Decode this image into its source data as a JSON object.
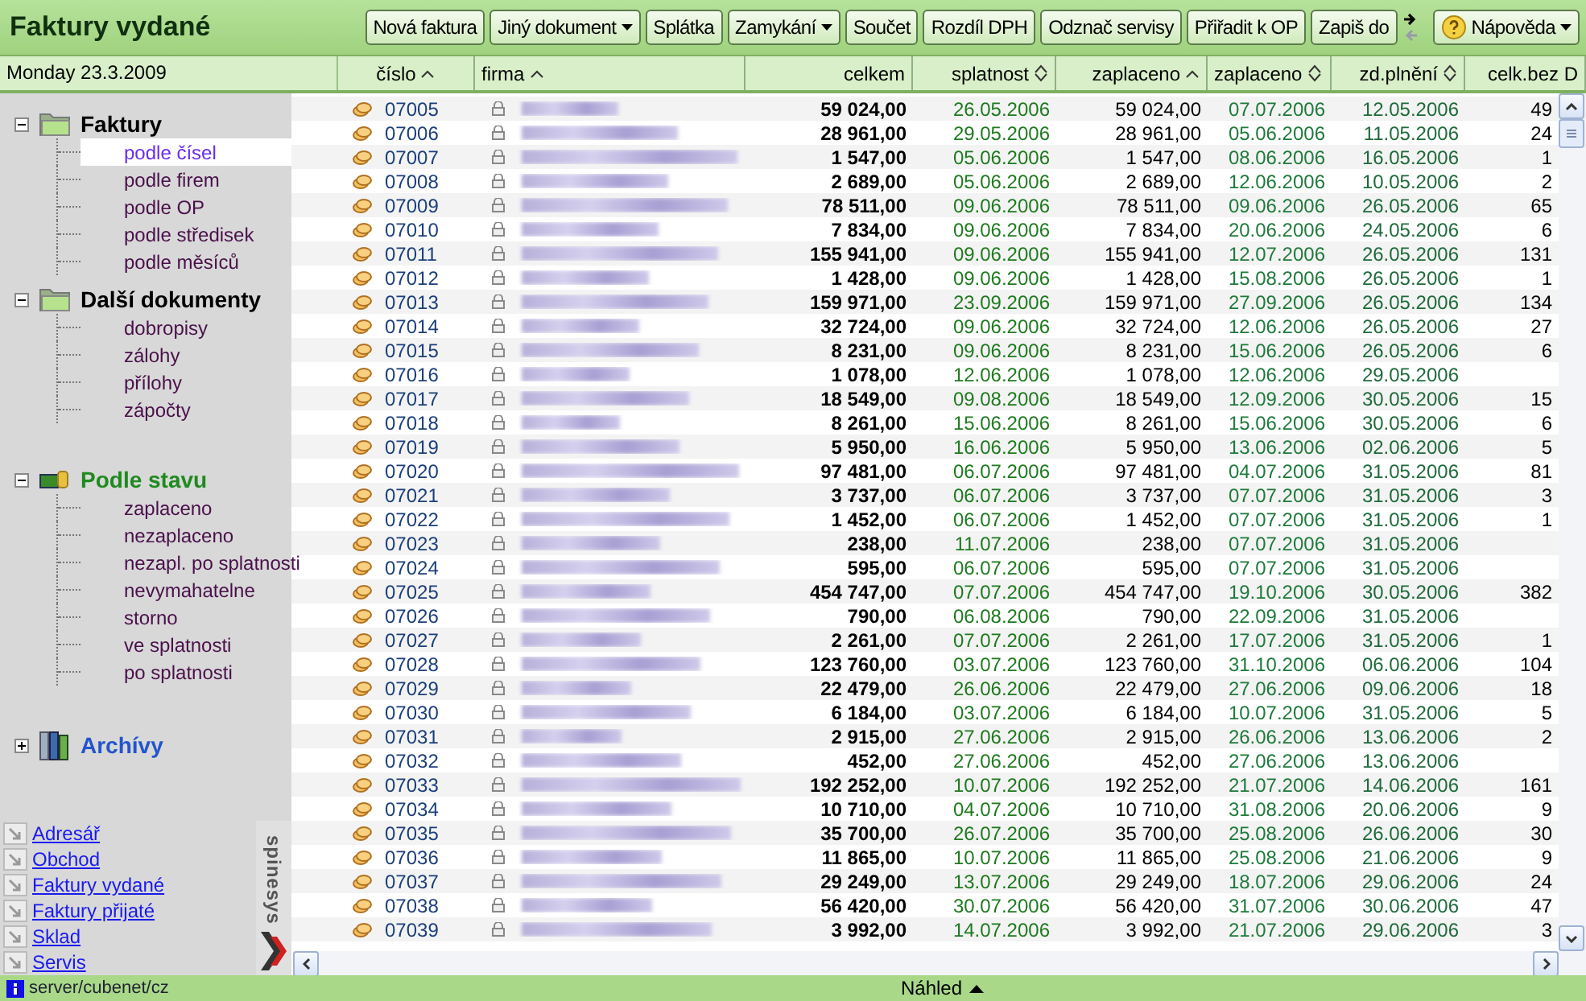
{
  "window": {
    "title": "Faktury vydané"
  },
  "toolbar": [
    {
      "label": "Nová faktura",
      "has_menu": false
    },
    {
      "label": "Jiný dokument",
      "has_menu": true
    },
    {
      "label": "Splátka",
      "has_menu": false
    },
    {
      "label": "Zamykání",
      "has_menu": true
    },
    {
      "label": "Součet",
      "has_menu": false
    },
    {
      "label": "Rozdíl DPH",
      "has_menu": false
    },
    {
      "label": "Odznač servisy",
      "has_menu": false
    },
    {
      "label": "Přiřadit k OP",
      "has_menu": false
    },
    {
      "label": "Zapiš do",
      "has_menu": false
    }
  ],
  "help_button": {
    "label": "Nápověda",
    "has_menu": true
  },
  "date_label": "Monday 23.3.2009",
  "sidebar": {
    "tree": [
      {
        "label": "Faktury",
        "kind": "folder",
        "color": "#000000",
        "expanded": true,
        "children": [
          {
            "label": "podle čísel",
            "selected": true
          },
          {
            "label": "podle firem",
            "selected": false
          },
          {
            "label": "podle OP",
            "selected": false
          },
          {
            "label": "podle středisek",
            "selected": false
          },
          {
            "label": "podle měsíců",
            "selected": false
          }
        ]
      },
      {
        "label": "Další dokumenty",
        "kind": "folder",
        "color": "#000000",
        "expanded": true,
        "children": [
          {
            "label": "dobropisy",
            "selected": false
          },
          {
            "label": "zálohy",
            "selected": false
          },
          {
            "label": "přílohy",
            "selected": false
          },
          {
            "label": "zápočty",
            "selected": false
          }
        ]
      },
      {
        "label": "Podle stavu",
        "kind": "money",
        "color": "#1f8a1f",
        "expanded": true,
        "children": [
          {
            "label": "zaplaceno",
            "selected": false
          },
          {
            "label": "nezaplaceno",
            "selected": false
          },
          {
            "label": "nezapl. po splatnosti",
            "selected": false
          },
          {
            "label": "nevymahatelne",
            "selected": false
          },
          {
            "label": "storno",
            "selected": false
          },
          {
            "label": "ve splatnosti",
            "selected": false
          },
          {
            "label": "po splatnosti",
            "selected": false
          }
        ]
      },
      {
        "label": "Archívy",
        "kind": "archive",
        "color": "#2255cc",
        "expanded": false
      }
    ],
    "links": [
      "Adresář",
      "Obchod",
      "Faktury vydané",
      "Faktury přijaté",
      "Sklad",
      "Servis"
    ],
    "logo": "spinesys"
  },
  "table": {
    "columns": [
      {
        "label": "číslo",
        "sortable": true,
        "sorted": true
      },
      {
        "label": "firma",
        "sortable": true,
        "sorted": true
      },
      {
        "label": "celkem",
        "sortable": false
      },
      {
        "label": "splatnost",
        "sortable": true,
        "sorted": false
      },
      {
        "label": "zaplaceno",
        "sortable": true,
        "sorted": true
      },
      {
        "label": "zaplaceno",
        "sortable": true,
        "sorted": false
      },
      {
        "label": "zd.plnění",
        "sortable": true,
        "sorted": false
      },
      {
        "label": "celk.bez D",
        "sortable": false
      }
    ],
    "rows": [
      {
        "number": "07005",
        "total": "59 024,00",
        "due": "26.05.2006",
        "paid": "59 024,00",
        "paid_on": "07.07.2006",
        "tax_date": "12.05.2006",
        "net": "49"
      },
      {
        "number": "07006",
        "total": "28 961,00",
        "due": "29.05.2006",
        "paid": "28 961,00",
        "paid_on": "05.06.2006",
        "tax_date": "11.05.2006",
        "net": "24"
      },
      {
        "number": "07007",
        "total": "1 547,00",
        "due": "05.06.2006",
        "paid": "1 547,00",
        "paid_on": "08.06.2006",
        "tax_date": "16.05.2006",
        "net": "1"
      },
      {
        "number": "07008",
        "total": "2 689,00",
        "due": "05.06.2006",
        "paid": "2 689,00",
        "paid_on": "12.06.2006",
        "tax_date": "10.05.2006",
        "net": "2"
      },
      {
        "number": "07009",
        "total": "78 511,00",
        "due": "09.06.2006",
        "paid": "78 511,00",
        "paid_on": "09.06.2006",
        "tax_date": "26.05.2006",
        "net": "65"
      },
      {
        "number": "07010",
        "total": "7 834,00",
        "due": "09.06.2006",
        "paid": "7 834,00",
        "paid_on": "20.06.2006",
        "tax_date": "24.05.2006",
        "net": "6"
      },
      {
        "number": "07011",
        "total": "155 941,00",
        "due": "09.06.2006",
        "paid": "155 941,00",
        "paid_on": "12.07.2006",
        "tax_date": "26.05.2006",
        "net": "131"
      },
      {
        "number": "07012",
        "total": "1 428,00",
        "due": "09.06.2006",
        "paid": "1 428,00",
        "paid_on": "15.08.2006",
        "tax_date": "26.05.2006",
        "net": "1"
      },
      {
        "number": "07013",
        "total": "159 971,00",
        "due": "23.09.2006",
        "paid": "159 971,00",
        "paid_on": "27.09.2006",
        "tax_date": "26.05.2006",
        "net": "134"
      },
      {
        "number": "07014",
        "total": "32 724,00",
        "due": "09.06.2006",
        "paid": "32 724,00",
        "paid_on": "12.06.2006",
        "tax_date": "26.05.2006",
        "net": "27"
      },
      {
        "number": "07015",
        "total": "8 231,00",
        "due": "09.06.2006",
        "paid": "8 231,00",
        "paid_on": "15.06.2006",
        "tax_date": "26.05.2006",
        "net": "6"
      },
      {
        "number": "07016",
        "total": "1 078,00",
        "due": "12.06.2006",
        "paid": "1 078,00",
        "paid_on": "12.06.2006",
        "tax_date": "29.05.2006"
      },
      {
        "number": "07017",
        "total": "18 549,00",
        "due": "09.08.2006",
        "paid": "18 549,00",
        "paid_on": "12.09.2006",
        "tax_date": "30.05.2006",
        "net": "15"
      },
      {
        "number": "07018",
        "total": "8 261,00",
        "due": "15.06.2006",
        "paid": "8 261,00",
        "paid_on": "15.06.2006",
        "tax_date": "30.05.2006",
        "net": "6"
      },
      {
        "number": "07019",
        "total": "5 950,00",
        "due": "16.06.2006",
        "paid": "5 950,00",
        "paid_on": "13.06.2006",
        "tax_date": "02.06.2006",
        "net": "5"
      },
      {
        "number": "07020",
        "total": "97 481,00",
        "due": "06.07.2006",
        "paid": "97 481,00",
        "paid_on": "04.07.2006",
        "tax_date": "31.05.2006",
        "net": "81"
      },
      {
        "number": "07021",
        "total": "3 737,00",
        "due": "06.07.2006",
        "paid": "3 737,00",
        "paid_on": "07.07.2006",
        "tax_date": "31.05.2006",
        "net": "3"
      },
      {
        "number": "07022",
        "total": "1 452,00",
        "due": "06.07.2006",
        "paid": "1 452,00",
        "paid_on": "07.07.2006",
        "tax_date": "31.05.2006",
        "net": "1"
      },
      {
        "number": "07023",
        "total": "238,00",
        "due": "11.07.2006",
        "paid": "238,00",
        "paid_on": "07.07.2006",
        "tax_date": "31.05.2006"
      },
      {
        "number": "07024",
        "total": "595,00",
        "due": "06.07.2006",
        "paid": "595,00",
        "paid_on": "07.07.2006",
        "tax_date": "31.05.2006"
      },
      {
        "number": "07025",
        "total": "454 747,00",
        "due": "07.07.2006",
        "paid": "454 747,00",
        "paid_on": "19.10.2006",
        "tax_date": "30.05.2006",
        "net": "382"
      },
      {
        "number": "07026",
        "total": "790,00",
        "due": "06.08.2006",
        "paid": "790,00",
        "paid_on": "22.09.2006",
        "tax_date": "31.05.2006"
      },
      {
        "number": "07027",
        "total": "2 261,00",
        "due": "07.07.2006",
        "paid": "2 261,00",
        "paid_on": "17.07.2006",
        "tax_date": "31.05.2006",
        "net": "1"
      },
      {
        "number": "07028",
        "total": "123 760,00",
        "due": "03.07.2006",
        "paid": "123 760,00",
        "paid_on": "31.10.2006",
        "tax_date": "06.06.2006",
        "net": "104"
      },
      {
        "number": "07029",
        "total": "22 479,00",
        "due": "26.06.2006",
        "paid": "22 479,00",
        "paid_on": "27.06.2006",
        "tax_date": "09.06.2006",
        "net": "18"
      },
      {
        "number": "07030",
        "total": "6 184,00",
        "due": "03.07.2006",
        "paid": "6 184,00",
        "paid_on": "10.07.2006",
        "tax_date": "31.05.2006",
        "net": "5"
      },
      {
        "number": "07031",
        "total": "2 915,00",
        "due": "27.06.2006",
        "paid": "2 915,00",
        "paid_on": "26.06.2006",
        "tax_date": "13.06.2006",
        "net": "2"
      },
      {
        "number": "07032",
        "total": "452,00",
        "due": "27.06.2006",
        "paid": "452,00",
        "paid_on": "27.06.2006",
        "tax_date": "13.06.2006"
      },
      {
        "number": "07033",
        "total": "192 252,00",
        "due": "10.07.2006",
        "paid": "192 252,00",
        "paid_on": "21.07.2006",
        "tax_date": "14.06.2006",
        "net": "161"
      },
      {
        "number": "07034",
        "total": "10 710,00",
        "due": "04.07.2006",
        "paid": "10 710,00",
        "paid_on": "31.08.2006",
        "tax_date": "20.06.2006",
        "net": "9"
      },
      {
        "number": "07035",
        "total": "35 700,00",
        "due": "26.07.2006",
        "paid": "35 700,00",
        "paid_on": "25.08.2006",
        "tax_date": "26.06.2006",
        "net": "30"
      },
      {
        "number": "07036",
        "total": "11 865,00",
        "due": "10.07.2006",
        "paid": "11 865,00",
        "paid_on": "25.08.2006",
        "tax_date": "21.06.2006",
        "net": "9"
      },
      {
        "number": "07037",
        "total": "29 249,00",
        "due": "13.07.2006",
        "paid": "29 249,00",
        "paid_on": "18.07.2006",
        "tax_date": "29.06.2006",
        "net": "24"
      },
      {
        "number": "07038",
        "total": "56 420,00",
        "due": "30.07.2006",
        "paid": "56 420,00",
        "paid_on": "31.07.2006",
        "tax_date": "30.06.2006",
        "net": "47"
      },
      {
        "number": "07039",
        "total": "3 992,00",
        "due": "14.07.2006",
        "paid": "3 992,00",
        "paid_on": "21.07.2006",
        "tax_date": "29.06.2006",
        "net": "3"
      }
    ]
  },
  "status_bar": {
    "server": "server/cubenet/cz",
    "preview": "Náhled"
  }
}
